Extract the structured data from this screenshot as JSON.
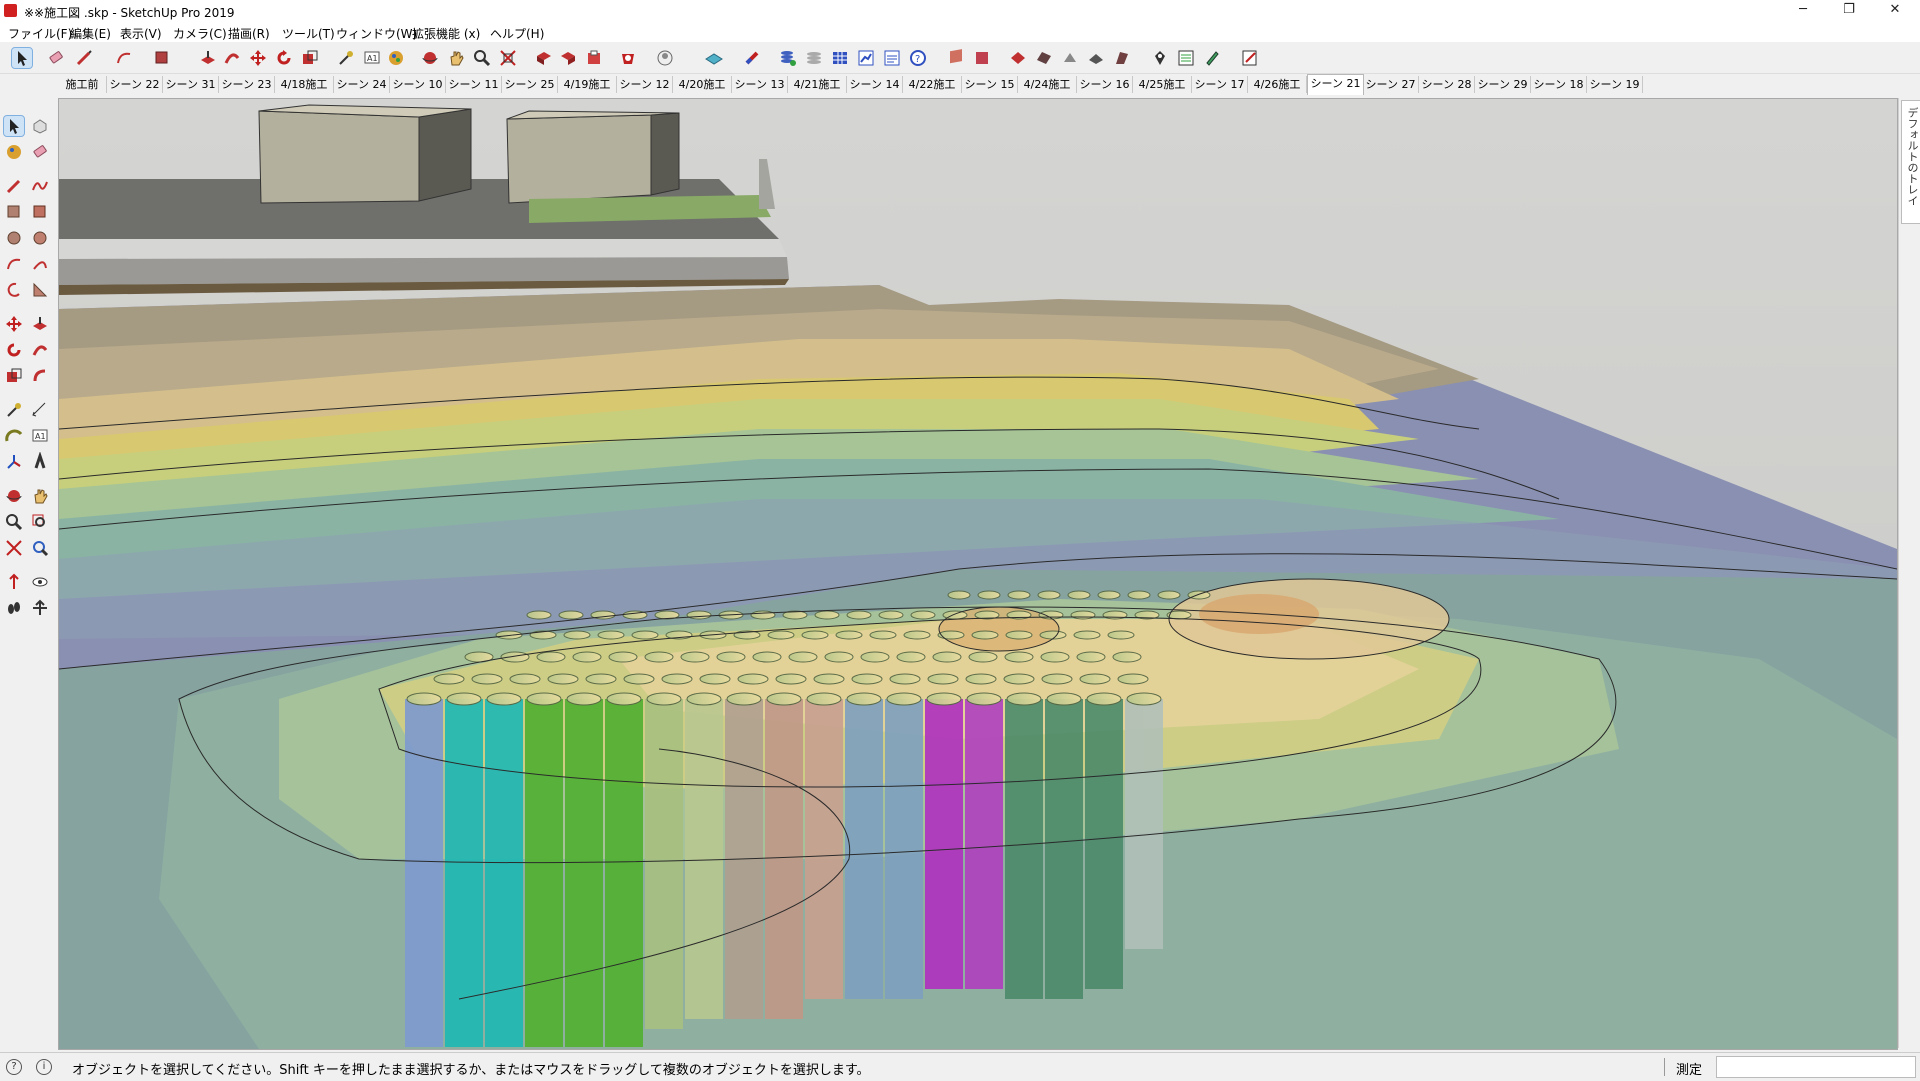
{
  "window": {
    "title": "※※施工図 .skp - SketchUp Pro 2019",
    "controls": [
      "─",
      "❐",
      "✕"
    ]
  },
  "menu": [
    "ファイル(F)",
    "編集(E)",
    "表示(V)",
    "カメラ(C)",
    "描画(R)",
    "ツール(T)",
    "ウィンドウ(W)",
    "拡張機能 (x)",
    "ヘルプ(H)"
  ],
  "scene_tabs": [
    "施工前",
    "シーン 22",
    "シーン 31",
    "シーン 23",
    "4/18施工",
    "シーン 24",
    "シーン 10",
    "シーン 11",
    "シーン 25",
    "4/19施工",
    "シーン 12",
    "4/20施工",
    "シーン 13",
    "4/21施工",
    "シーン 14",
    "4/22施工",
    "シーン 15",
    "4/24施工",
    "シーン 16",
    "4/25施工",
    "シーン 17",
    "4/26施工",
    "シーン 21",
    "シーン 27",
    "シーン 28",
    "シーン 29",
    "シーン 18",
    "シーン 19"
  ],
  "active_scene": "シーン 21",
  "tray": {
    "label": "デフォルトのトレイ"
  },
  "status": {
    "message": "オブジェクトを選択してください。Shift キーを押したまま選択するか、またはマウスをドラッグして複数のオブジェクトを選択します。",
    "measure_label": "測定",
    "measure_value": ""
  },
  "colors": {
    "accent": "#cfe3f7",
    "background": "#d9d9d6",
    "ground_blue": "#8790b3",
    "contour_green": "#7fa88c",
    "contour_yellow": "#d9cf7a"
  }
}
